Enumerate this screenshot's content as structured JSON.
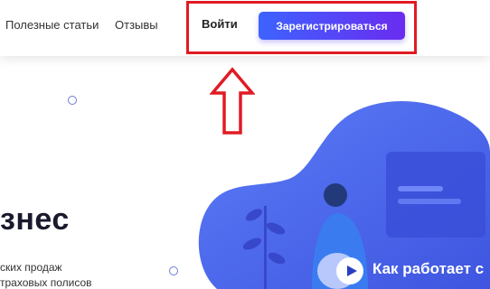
{
  "nav": {
    "articles": "Полезные статьи",
    "reviews": "Отзывы",
    "login": "Войти",
    "register": "Зарегистрироваться"
  },
  "hero": {
    "title": "знес",
    "line_1": "ских продаж",
    "line_2": "траховых полисов"
  },
  "video": {
    "label": "Как работает с"
  },
  "colors": {
    "accent_start": "#3d63ff",
    "accent_end": "#6a2cf0",
    "highlight": "#e01b24",
    "illustration": "#4f6ef5"
  }
}
